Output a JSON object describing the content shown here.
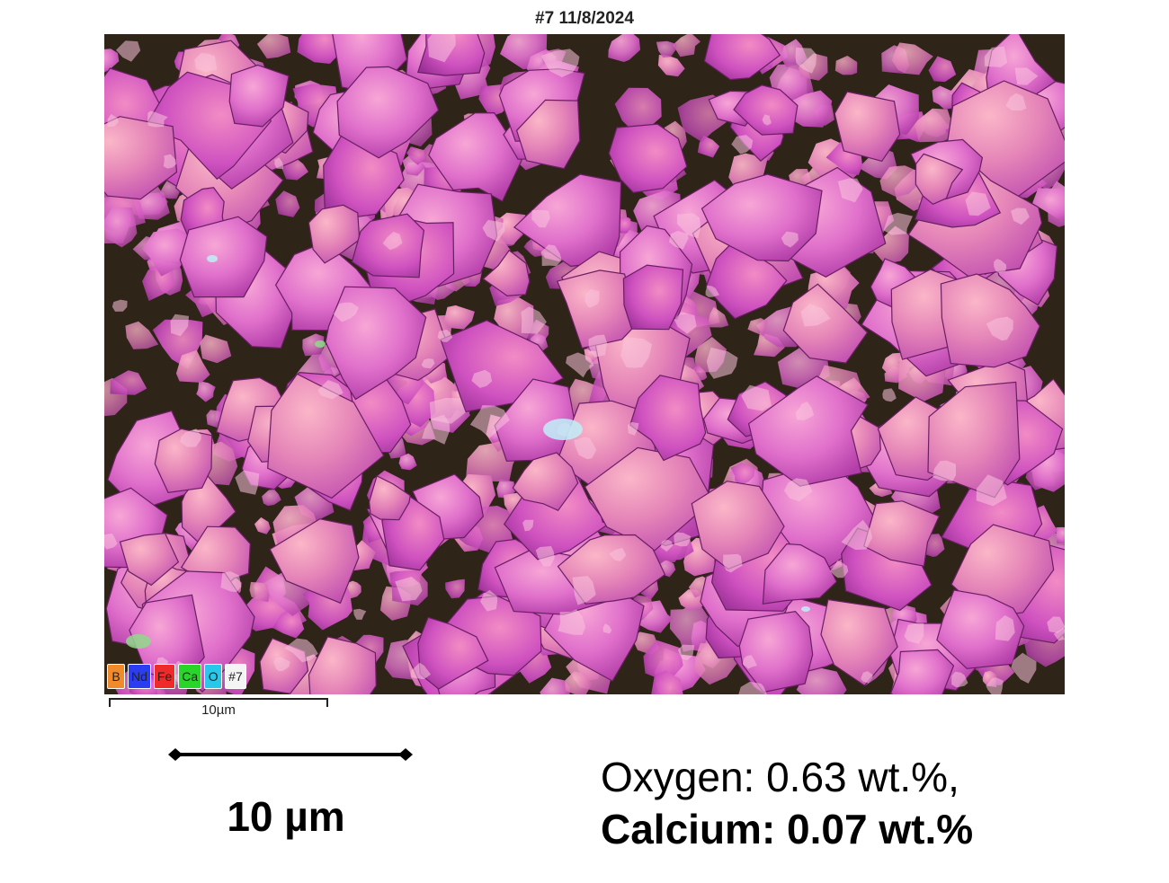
{
  "title": "#7 11/8/2024",
  "legend": [
    {
      "label": "B",
      "color": "#f08a2a",
      "icon": "element-chip"
    },
    {
      "label": "Nd",
      "color": "#2b3df0",
      "icon": "element-chip"
    },
    {
      "label": "Fe",
      "color": "#ef2a2a",
      "icon": "element-chip"
    },
    {
      "label": "Ca",
      "color": "#2ad52a",
      "icon": "element-chip"
    },
    {
      "label": "O",
      "color": "#29c8e8",
      "icon": "element-chip"
    },
    {
      "label": "#7",
      "color": "#f4f4f4",
      "icon": "element-chip"
    }
  ],
  "map_colors": {
    "matrix": "#c44fb7",
    "grain_base": "#d35cc6",
    "grain_light": "#ec8fcf",
    "gaps": "#2f2418",
    "ca_highlight": "#8fd98a",
    "o_highlight": "#bfeef8"
  },
  "small_scale_label": "10µm",
  "big_scale_label": "10 µm",
  "composition": {
    "line1": "Oxygen: 0.63 wt.%,",
    "line2": "Calcium: 0.07 wt.%"
  }
}
